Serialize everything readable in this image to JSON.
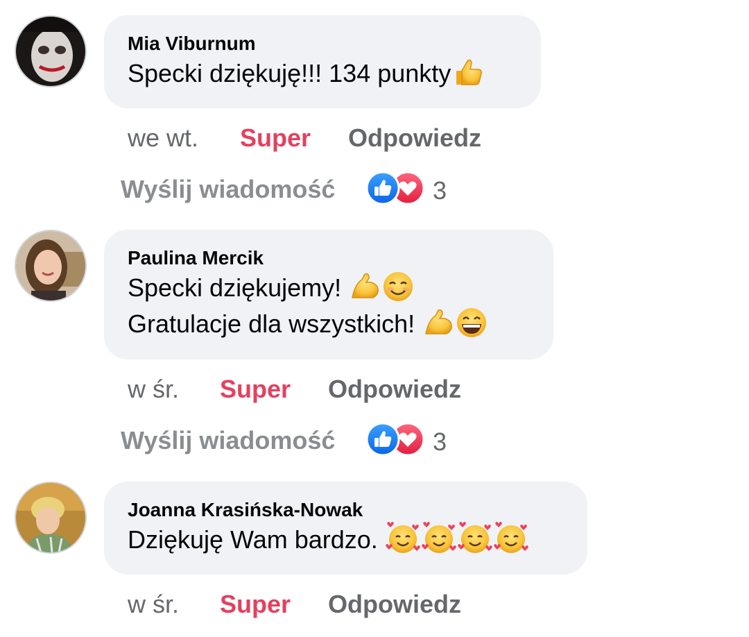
{
  "colors": {
    "bubble_bg": "#f0f2f5",
    "super_red": "#e4405f",
    "secondary_text": "#65676b",
    "like_blue": "#1877f2",
    "love_red": "#f33e58"
  },
  "comments": [
    {
      "author": "Mia Viburnum",
      "lines": [
        "Specki dziękuję!!! 134 punkty"
      ],
      "line_emojis": [
        [
          "thumbs-up-emoji"
        ]
      ],
      "time": "we wt.",
      "like_label": "Super",
      "reply_label": "Odpowiedz",
      "send_label": "Wyślij wiadomość",
      "reaction_count": "3",
      "reaction_icons": [
        "like-icon",
        "love-icon"
      ]
    },
    {
      "author": "Paulina Mercik",
      "lines": [
        "Specki dziękujemy! ",
        "Gratulacje dla wszystkich! "
      ],
      "line_emojis": [
        [
          "flexed-biceps-emoji",
          "smiling-face-emoji"
        ],
        [
          "flexed-biceps-emoji",
          "grinning-face-emoji"
        ]
      ],
      "time": "w śr.",
      "like_label": "Super",
      "reply_label": "Odpowiedz",
      "send_label": "Wyślij wiadomość",
      "reaction_count": "3",
      "reaction_icons": [
        "like-icon",
        "love-icon"
      ]
    },
    {
      "author": "Joanna Krasińska-Nowak",
      "lines": [
        "Dziękuję  Wam bardzo. "
      ],
      "line_emojis": [
        [
          "smiling-face-with-hearts-emoji",
          "smiling-face-with-hearts-emoji",
          "smiling-face-with-hearts-emoji",
          "smiling-face-with-hearts-emoji"
        ]
      ],
      "time": "w śr.",
      "like_label": "Super",
      "reply_label": "Odpowiedz"
    }
  ]
}
